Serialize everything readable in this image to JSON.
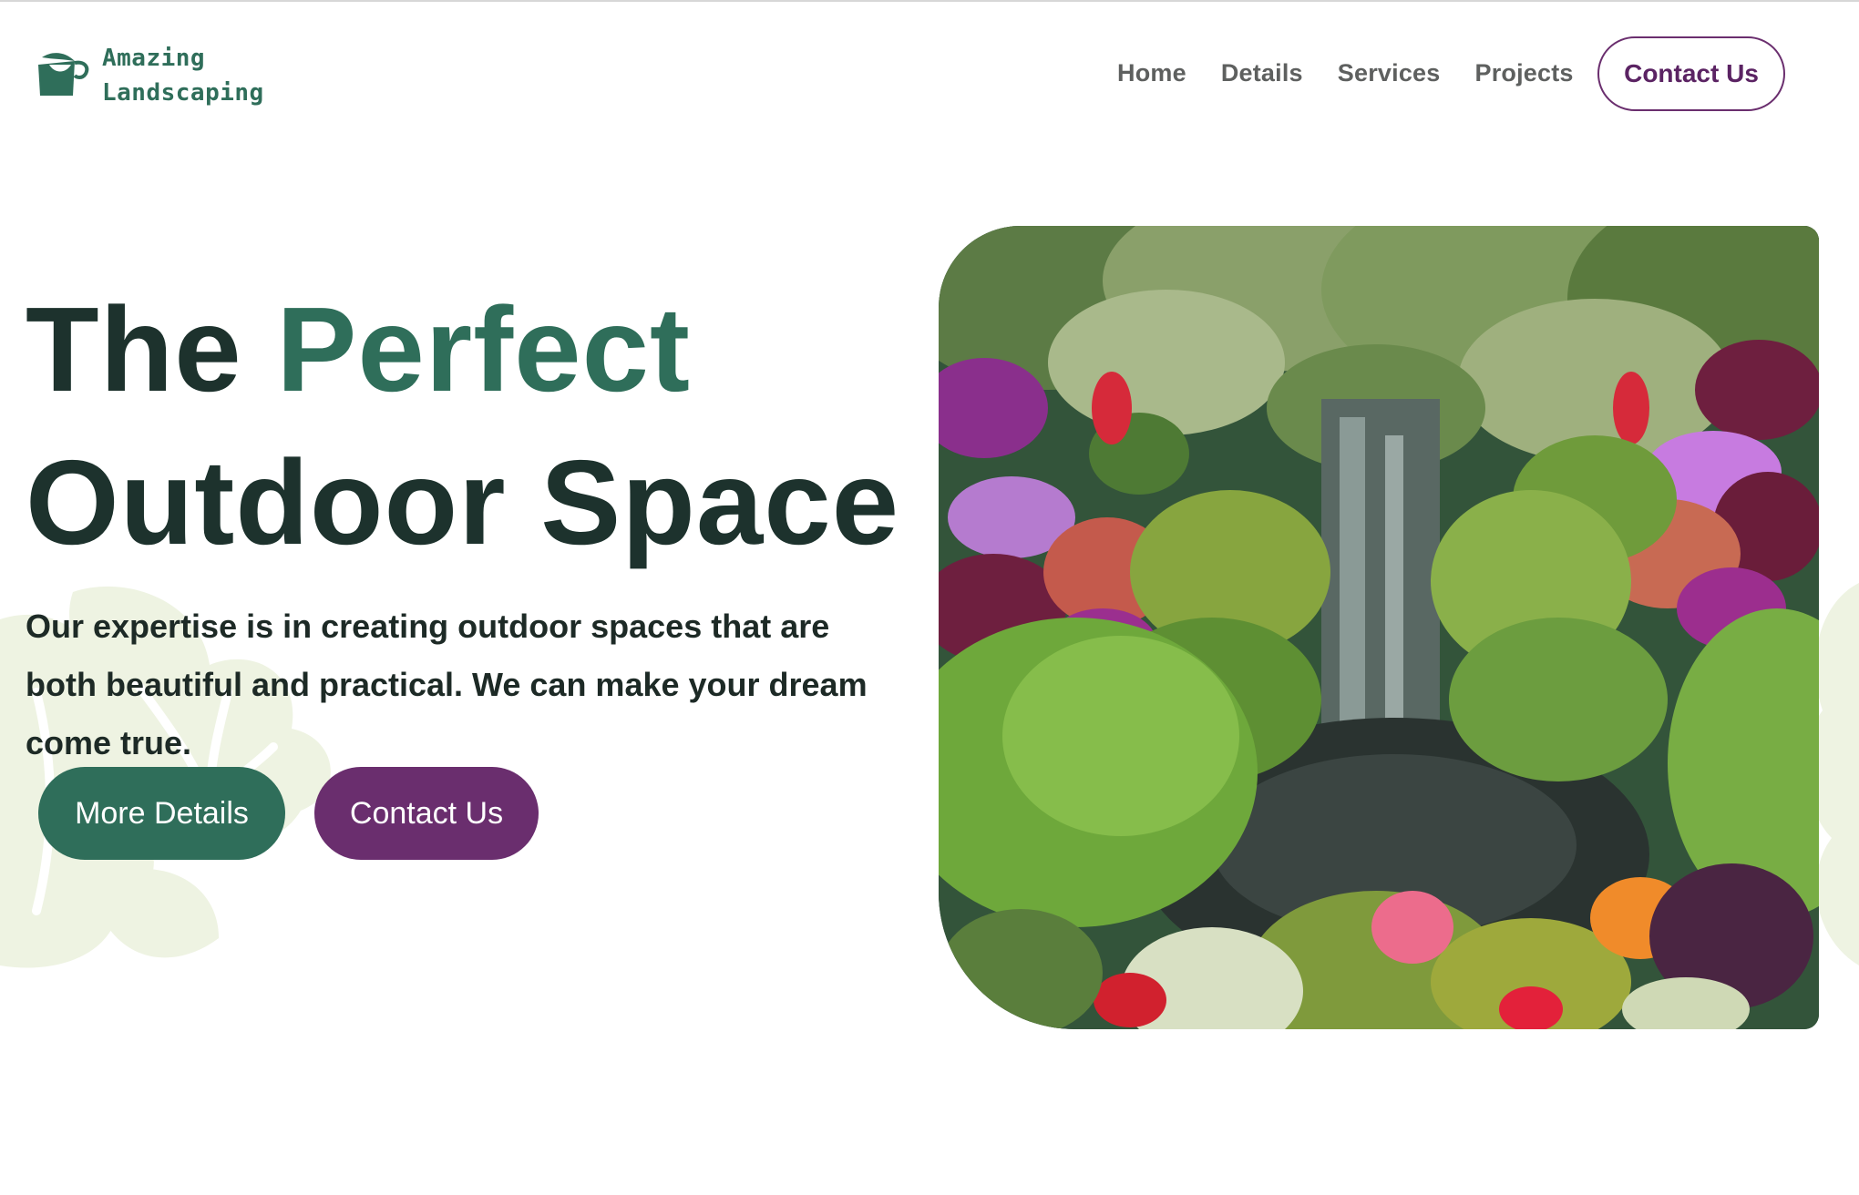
{
  "brand": {
    "line1": "Amazing",
    "line2": "Landscaping",
    "logo_icon": "bucket-leaf-icon"
  },
  "nav": {
    "items": [
      {
        "label": "Home"
      },
      {
        "label": "Details"
      },
      {
        "label": "Services"
      },
      {
        "label": "Projects"
      }
    ],
    "cta_label": "Contact Us"
  },
  "hero": {
    "title_word_1": "The",
    "title_word_2": "Perfect",
    "title_line_2": "Outdoor Space",
    "description": "Our expertise is in creating outdoor spaces that are both beautiful and practical. We can make your dream come true.",
    "primary_button": "More Details",
    "secondary_button": "Contact Us"
  },
  "colors": {
    "brand_green": "#2f6e5a",
    "brand_purple": "#6a2e6e",
    "heading_dark": "#1d322d",
    "nav_gray": "#5e605f",
    "leaf_tint": "#eef3e2"
  }
}
